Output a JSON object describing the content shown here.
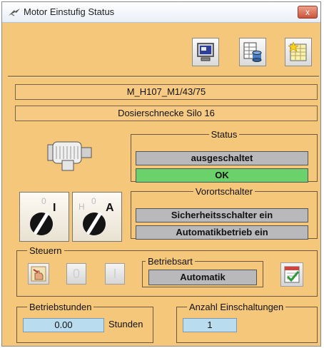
{
  "window": {
    "title": "Motor Einstufig Status",
    "close_label": "x"
  },
  "header": {
    "id_label": "M_H107_M1/43/75",
    "description": "Dosierschnecke Silo 16"
  },
  "status": {
    "legend": "Status",
    "state": "ausgeschaltet",
    "health": "OK"
  },
  "local_switch": {
    "legend": "Vorortschalter",
    "items": [
      "Sicherheitsschalter ein",
      "Automatikbetrieb ein"
    ]
  },
  "switches": {
    "onoff": {
      "zero": "0",
      "one": "I"
    },
    "handauto": {
      "hand": "H",
      "zero": "0",
      "auto": "A"
    }
  },
  "control": {
    "legend": "Steuern",
    "btn_zero": "0",
    "btn_one": "I",
    "mode_legend": "Betriebsart",
    "mode_value": "Automatik"
  },
  "operating_hours": {
    "legend": "Betriebstunden",
    "value": "0.00",
    "unit": "Stunden"
  },
  "switch_count": {
    "legend": "Anzahl Einschaltungen",
    "value": "1"
  },
  "colors": {
    "panel": "#f4c77a",
    "ok_green": "#6bd16a",
    "field_gray": "#b9b9bc",
    "value_blue": "#b9dcef"
  }
}
